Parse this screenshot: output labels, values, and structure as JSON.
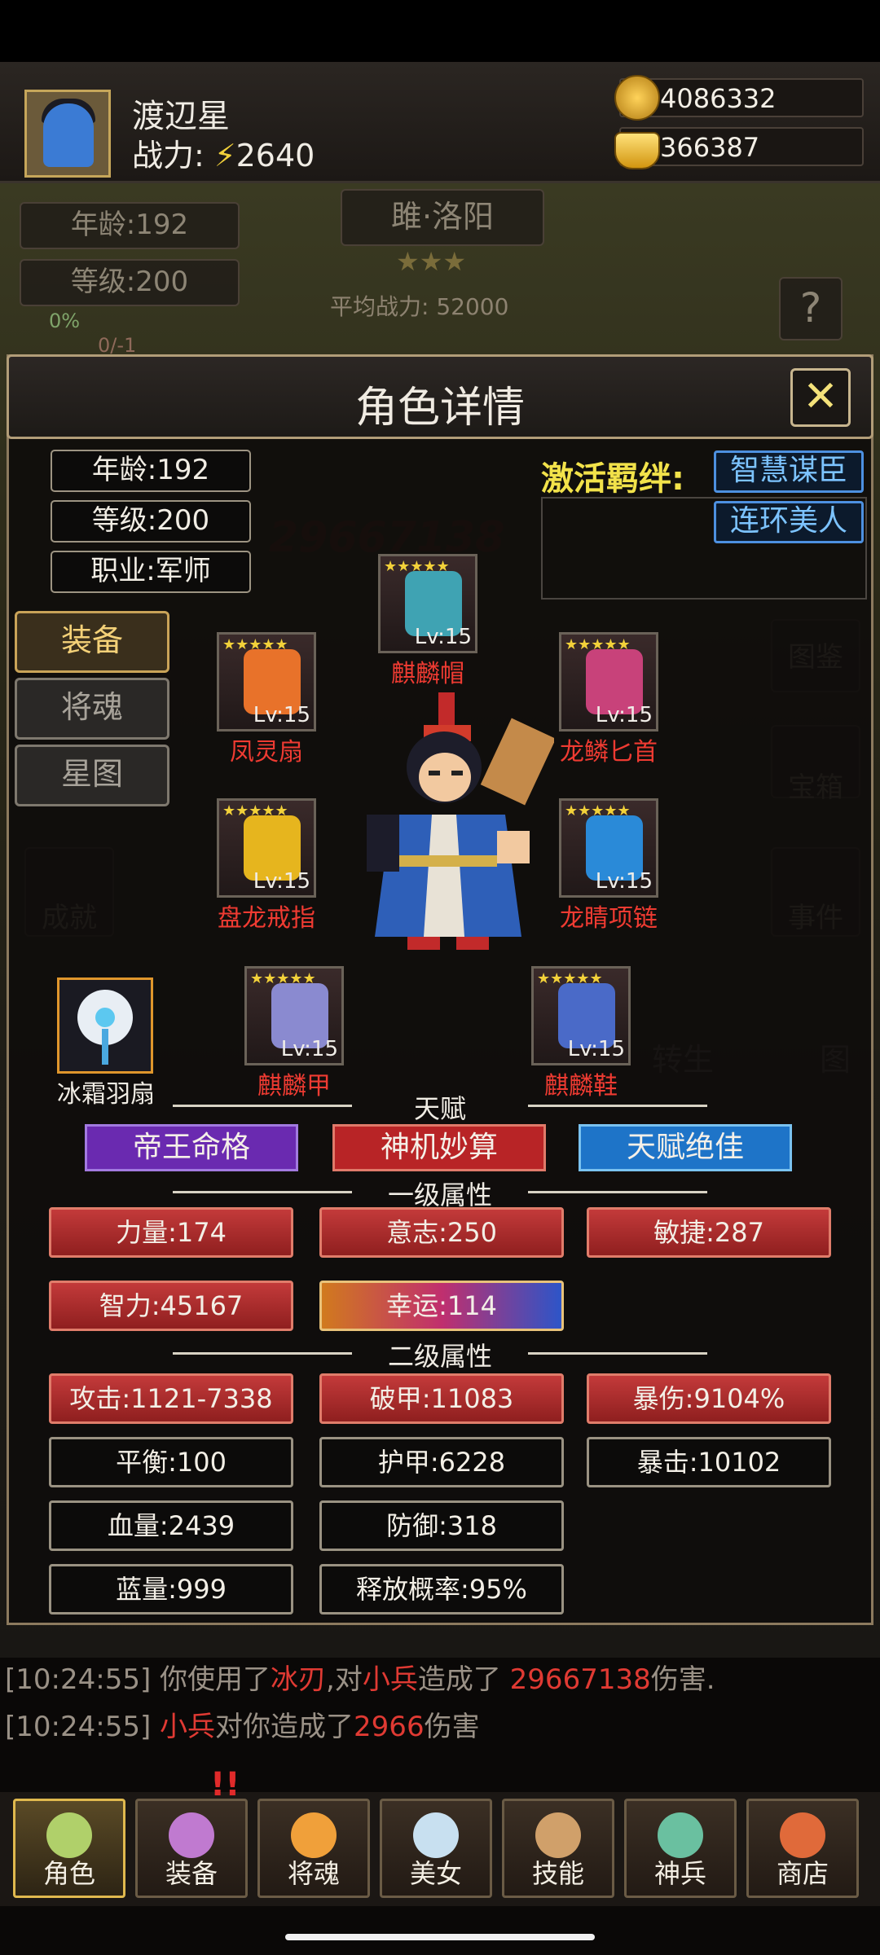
{
  "player": {
    "name": "渡辺星",
    "power_label": "战力:",
    "power_value": "2640"
  },
  "resources": {
    "gold": "4086332",
    "ingot": "366387"
  },
  "background": {
    "age": "年龄:192",
    "level": "等级:200",
    "exp_percent": "0%",
    "exp_count": "0/-1",
    "stage": "雎·洛阳",
    "avg_power": "平均战力: 52000",
    "help": "?",
    "right_buttons": [
      "图鉴",
      "宝箱",
      "事件"
    ],
    "left_buttons": [
      "成就"
    ],
    "ghost_number": "29667138",
    "rebirth": "转生",
    "map": "图"
  },
  "panel": {
    "title": "角色详情",
    "stats": {
      "age": "年龄:192",
      "level": "等级:200",
      "job": "职业:军师"
    },
    "tabs": [
      "装备",
      "将魂",
      "星图"
    ],
    "active_tab": "装备",
    "bond_label": "激活羁绊:",
    "bonds": [
      "智慧谋臣",
      "连环美人"
    ],
    "equipment": [
      {
        "name": "麒麟帽",
        "level": "Lv:15",
        "stars": 5,
        "color": "#3fa3b3"
      },
      {
        "name": "凤灵扇",
        "level": "Lv:15",
        "stars": 5,
        "color": "#e8722a"
      },
      {
        "name": "龙鳞匕首",
        "level": "Lv:15",
        "stars": 5,
        "color": "#c8427a"
      },
      {
        "name": "盘龙戒指",
        "level": "Lv:15",
        "stars": 5,
        "color": "#e6b51e"
      },
      {
        "name": "龙睛项链",
        "level": "Lv:15",
        "stars": 5,
        "color": "#2a8ad8"
      },
      {
        "name": "麒麟甲",
        "level": "Lv:15",
        "stars": 5,
        "color": "#8a8ad0"
      },
      {
        "name": "麒麟鞋",
        "level": "Lv:15",
        "stars": 5,
        "color": "#4a6ac8"
      }
    ],
    "weapon": {
      "name": "冰霜羽扇"
    },
    "talent_title": "天赋",
    "talents": [
      {
        "label": "帝王命格",
        "color": "#6a2ab0"
      },
      {
        "label": "神机妙算",
        "color": "#b82426"
      },
      {
        "label": "天赋绝佳",
        "color": "#1e74c8"
      }
    ],
    "primary_title": "一级属性",
    "primary": [
      {
        "label": "力量:174",
        "style": "red"
      },
      {
        "label": "意志:250",
        "style": "red"
      },
      {
        "label": "敏捷:287",
        "style": "red"
      },
      {
        "label": "智力:45167",
        "style": "red"
      },
      {
        "label": "幸运:114",
        "style": "grad"
      }
    ],
    "secondary_title": "二级属性",
    "secondary": [
      {
        "label": "攻击:1121-7338",
        "style": "red"
      },
      {
        "label": "破甲:11083",
        "style": "red"
      },
      {
        "label": "暴伤:9104%",
        "style": "red"
      },
      {
        "label": "平衡:100",
        "style": "dark"
      },
      {
        "label": "护甲:6228",
        "style": "dark"
      },
      {
        "label": "暴击:10102",
        "style": "dark"
      },
      {
        "label": "血量:2439",
        "style": "dark"
      },
      {
        "label": "防御:318",
        "style": "dark"
      },
      {
        "label": "蓝量:999",
        "style": "dark"
      },
      {
        "label": "释放概率:95%",
        "style": "dark"
      }
    ]
  },
  "log": [
    {
      "time": "[10:24:55]",
      "a": "你使用了",
      "b": "冰刃",
      "c": ",对",
      "d": "小兵",
      "e": "造成了 ",
      "f": "29667138",
      "g": "伤害."
    },
    {
      "time": "[10:24:55]",
      "a": "",
      "b": "小兵",
      "c": "对你造成了",
      "d": "2966",
      "e": "伤害",
      "f": "",
      "g": ""
    }
  ],
  "nav": [
    "角色",
    "装备",
    "将魂",
    "美女",
    "技能",
    "神兵",
    "商店"
  ],
  "nav_badge": "!!"
}
